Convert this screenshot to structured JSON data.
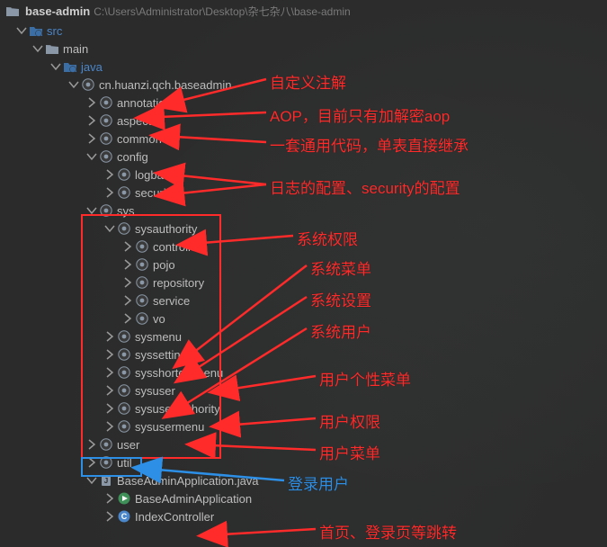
{
  "breadcrumb": {
    "root": "base-admin",
    "path": "C:\\Users\\Administrator\\Desktop\\杂七杂八\\base-admin"
  },
  "tree": {
    "src": "src",
    "main": "main",
    "java": "java",
    "pkg_root": "cn.huanzi.qch.baseadmin",
    "annotation": "annotation",
    "aspect": "aspect",
    "common": "common",
    "config": "config",
    "logback": "logback",
    "security": "security",
    "sys": "sys",
    "sysauthority": "sysauthority",
    "controller": "controller",
    "pojo": "pojo",
    "repository": "repository",
    "service": "service",
    "vo": "vo",
    "sysmenu": "sysmenu",
    "syssetting": "syssetting",
    "sysshortcutmenu": "sysshortcutmenu",
    "sysuser": "sysuser",
    "sysuserauthority": "sysuserauthority",
    "sysusermenu": "sysusermenu",
    "user": "user",
    "util": "util",
    "app_java": "BaseAdminApplication.java",
    "app_class": "BaseAdminApplication",
    "index_ctrl": "IndexController"
  },
  "annotations": {
    "a1": "自定义注解",
    "a2": "AOP，目前只有加解密aop",
    "a3": "一套通用代码，单表直接继承",
    "a4": "日志的配置、security的配置",
    "a5": "系统权限",
    "a6": "系统菜单",
    "a7": "系统设置",
    "a8": "系统用户",
    "a9": "用户个性菜单",
    "a10": "用户权限",
    "a11": "用户菜单",
    "a12": "登录用户",
    "a13": "首页、登录页等跳转"
  }
}
